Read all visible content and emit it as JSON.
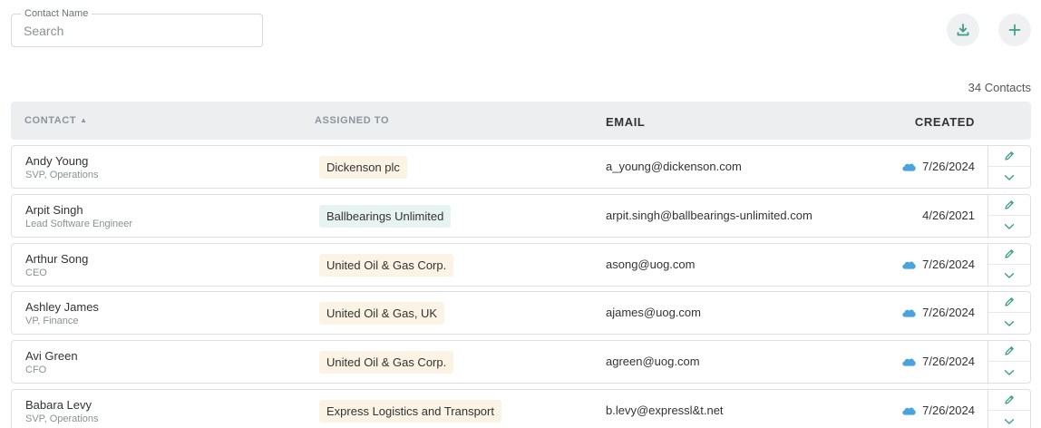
{
  "search": {
    "legend": "Contact Name",
    "placeholder": "Search",
    "value": ""
  },
  "toolbar": {
    "download_icon": "download-icon",
    "add_icon": "plus-icon"
  },
  "count_label": "34 Contacts",
  "columns": {
    "contact": "CONTACT",
    "assigned": "ASSIGNED TO",
    "email": "EMAIL",
    "created": "CREATED"
  },
  "colors": {
    "accent": "#3a9e8a",
    "tag_orange": "#fbf3e4",
    "tag_teal": "#e7f3f2",
    "cloud": "#4aa3df"
  },
  "rows": [
    {
      "name": "Andy Young",
      "title": "SVP, Operations",
      "assigned": "Dickenson plc",
      "tag": "orange",
      "email": "a_young@dickenson.com",
      "created": "7/26/2024",
      "cloud": true
    },
    {
      "name": "Arpit Singh",
      "title": "Lead Software Engineer",
      "assigned": "Ballbearings Unlimited",
      "tag": "teal",
      "email": "arpit.singh@ballbearings-unlimited.com",
      "created": "4/26/2021",
      "cloud": false
    },
    {
      "name": "Arthur Song",
      "title": "CEO",
      "assigned": "United Oil & Gas Corp.",
      "tag": "orange",
      "email": "asong@uog.com",
      "created": "7/26/2024",
      "cloud": true
    },
    {
      "name": "Ashley James",
      "title": "VP, Finance",
      "assigned": "United Oil & Gas, UK",
      "tag": "orange",
      "email": "ajames@uog.com",
      "created": "7/26/2024",
      "cloud": true
    },
    {
      "name": "Avi Green",
      "title": "CFO",
      "assigned": "United Oil & Gas Corp.",
      "tag": "orange",
      "email": "agreen@uog.com",
      "created": "7/26/2024",
      "cloud": true
    },
    {
      "name": "Babara Levy",
      "title": "SVP, Operations",
      "assigned": "Express Logistics and Transport",
      "tag": "orange",
      "email": "b.levy@expressl&t.net",
      "created": "7/26/2024",
      "cloud": true
    }
  ]
}
